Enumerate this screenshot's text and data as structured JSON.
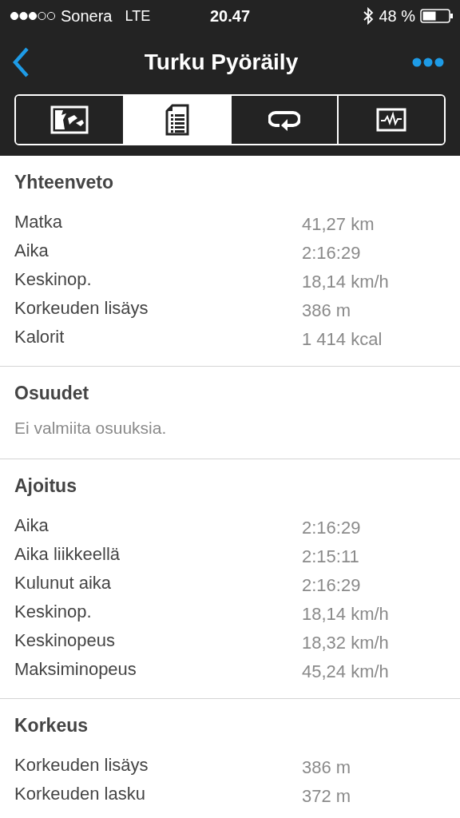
{
  "status_bar": {
    "carrier": "Sonera",
    "network": "LTE",
    "time": "20.47",
    "battery": "48 %"
  },
  "nav": {
    "title": "Turku Pyöräily"
  },
  "tabs": [
    {
      "kind": "map",
      "selected": false
    },
    {
      "kind": "summary",
      "selected": true
    },
    {
      "kind": "laps",
      "selected": false
    },
    {
      "kind": "graph",
      "selected": false
    }
  ],
  "sections": [
    {
      "title": "Yhteenveto",
      "rows": [
        {
          "label": "Matka",
          "value": "41,27 km"
        },
        {
          "label": "Aika",
          "value": "2:16:29"
        },
        {
          "label": "Keskinop.",
          "value": "18,14 km/h"
        },
        {
          "label": "Korkeuden lisäys",
          "value": "386 m"
        },
        {
          "label": "Kalorit",
          "value": "1 414 kcal"
        }
      ]
    },
    {
      "title": "Osuudet",
      "message": "Ei valmiita osuuksia."
    },
    {
      "title": "Ajoitus",
      "rows": [
        {
          "label": "Aika",
          "value": "2:16:29"
        },
        {
          "label": "Aika liikkeellä",
          "value": "2:15:11"
        },
        {
          "label": "Kulunut aika",
          "value": "2:16:29"
        },
        {
          "label": "Keskinop.",
          "value": "18,14 km/h"
        },
        {
          "label": "Keskinopeus",
          "value": "18,32 km/h"
        },
        {
          "label": "Maksiminopeus",
          "value": "45,24 km/h"
        }
      ]
    },
    {
      "title": "Korkeus",
      "rows": [
        {
          "label": "Korkeuden lisäys",
          "value": "386 m"
        },
        {
          "label": "Korkeuden lasku",
          "value": "372 m"
        }
      ]
    }
  ]
}
